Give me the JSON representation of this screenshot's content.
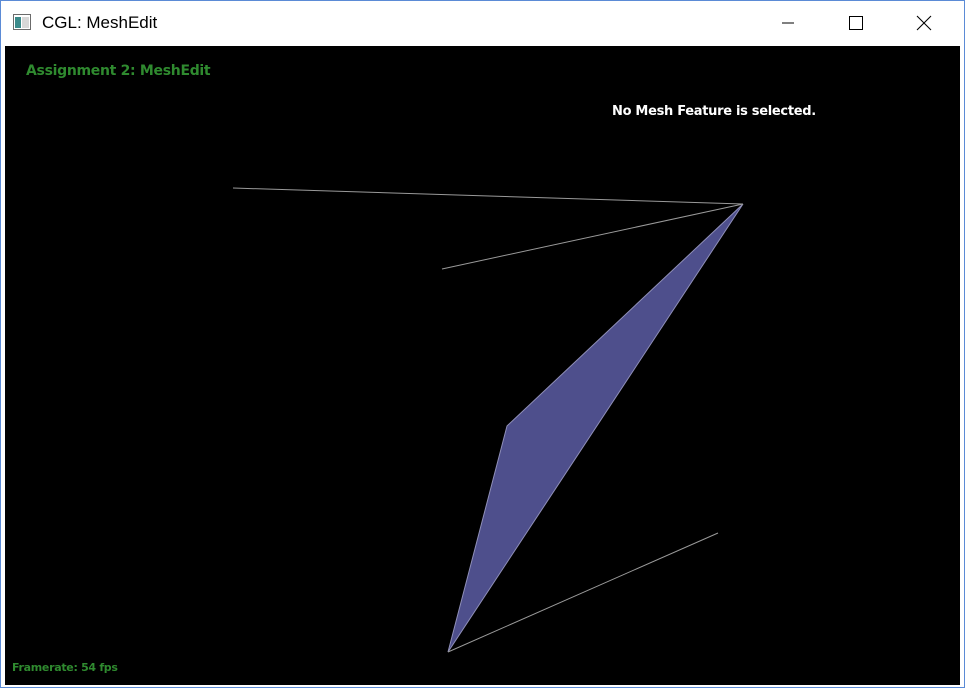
{
  "window": {
    "title": "CGL: MeshEdit",
    "icon": "app-window-icon",
    "controls": {
      "minimize_icon": "minimize-icon",
      "maximize_icon": "maximize-icon",
      "close_icon": "close-icon"
    }
  },
  "viewport": {
    "assignment_title": "Assignment 2: MeshEdit",
    "selection_status": "No Mesh Feature is selected.",
    "framerate": "Framerate: 54 fps"
  },
  "colors": {
    "background": "#000000",
    "hud_green": "#2f8a2f",
    "status_white": "#ffffff",
    "face_fill": "#4e4f8c",
    "edge_stroke": "#9a9a9a"
  }
}
